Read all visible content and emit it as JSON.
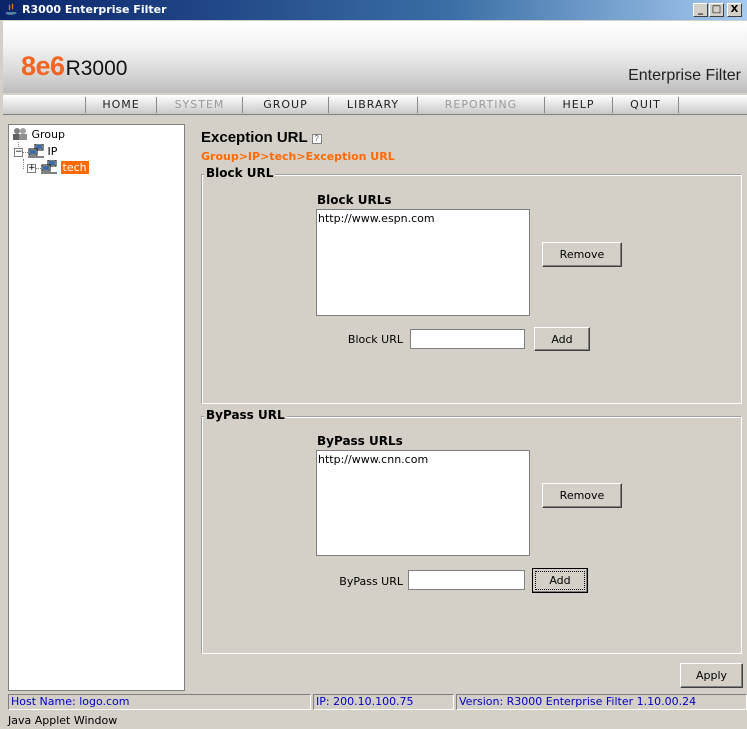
{
  "window": {
    "title": "R3000 Enterprise Filter",
    "minimize_glyph": "_",
    "maximize_glyph": "□",
    "close_glyph": "X"
  },
  "banner": {
    "brand": "8e6",
    "model": "R3000",
    "product": "Enterprise Filter",
    "brand_color": "#f26522"
  },
  "nav": {
    "items": [
      {
        "label": "HOME",
        "enabled": true
      },
      {
        "label": "SYSTEM",
        "enabled": false
      },
      {
        "label": "GROUP",
        "enabled": true
      },
      {
        "label": "LIBRARY",
        "enabled": true
      },
      {
        "label": "REPORTING",
        "enabled": false
      },
      {
        "label": "HELP",
        "enabled": true
      },
      {
        "label": "QUIT",
        "enabled": true
      }
    ]
  },
  "tree": {
    "root_label": "Group",
    "ip_label": "IP",
    "selected_label": "tech",
    "selected_color": "#ff6a00"
  },
  "content": {
    "title": "Exception URL",
    "help_icon": "help-icon",
    "breadcrumb": "Group>IP>tech>Exception URL",
    "block": {
      "group_title": "Block URL",
      "list_label": "Block URLs",
      "items": [
        "http://www.espn.com"
      ],
      "remove_label": "Remove",
      "field_label": "Block URL",
      "field_value": "",
      "add_label": "Add"
    },
    "bypass": {
      "group_title": "ByPass URL",
      "list_label": "ByPass URLs",
      "items": [
        "http://www.cnn.com"
      ],
      "remove_label": "Remove",
      "field_label": "ByPass URL",
      "field_value": "",
      "add_label": "Add"
    },
    "apply_label": "Apply"
  },
  "status": {
    "host": "Host Name: logo.com",
    "ip": "IP: 200.10.100.75",
    "version": "Version: R3000 Enterprise Filter 1.10.00.24",
    "text_color": "#0000c8"
  },
  "footer": {
    "label": "Java Applet Window"
  }
}
